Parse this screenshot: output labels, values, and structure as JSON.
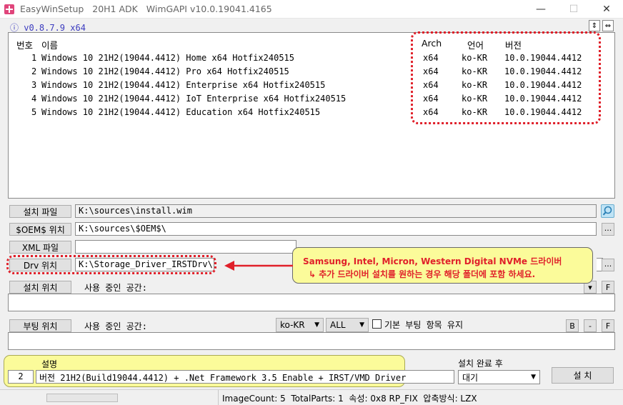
{
  "window": {
    "title": "EasyWinSetup   20H1 ADK   WimGAPI v10.0.19041.4165",
    "min_glyph": "—",
    "max_glyph": "☐",
    "close_glyph": "✕"
  },
  "version": "ⓘ v0.8.7.9 x64",
  "toolbar": {
    "sort_glyph": "⇕",
    "expand_glyph": "⇔"
  },
  "list": {
    "headers": {
      "num": "번호",
      "name": "이름",
      "arch": "Arch",
      "lang": "언어",
      "ver": "버전"
    },
    "rows": [
      {
        "num": "1",
        "name": "Windows 10 21H2(19044.4412) Home x64 Hotfix240515",
        "arch": "x64",
        "lang": "ko-KR",
        "ver": "10.0.19044.4412"
      },
      {
        "num": "2",
        "name": "Windows 10 21H2(19044.4412) Pro x64 Hotfix240515",
        "arch": "x64",
        "lang": "ko-KR",
        "ver": "10.0.19044.4412"
      },
      {
        "num": "3",
        "name": "Windows 10 21H2(19044.4412) Enterprise x64 Hotfix240515",
        "arch": "x64",
        "lang": "ko-KR",
        "ver": "10.0.19044.4412"
      },
      {
        "num": "4",
        "name": "Windows 10 21H2(19044.4412) IoT Enterprise x64 Hotfix240515",
        "arch": "x64",
        "lang": "ko-KR",
        "ver": "10.0.19044.4412"
      },
      {
        "num": "5",
        "name": "Windows 10 21H2(19044.4412) Education x64 Hotfix240515",
        "arch": "x64",
        "lang": "ko-KR",
        "ver": "10.0.19044.4412"
      }
    ]
  },
  "paths": {
    "install_label": "설치 파일",
    "install_value": "K:\\sources\\install.wim",
    "oem_label": "$OEM$ 위치",
    "oem_value": "K:\\sources\\$OEM$\\",
    "xml_label": "XML 파일",
    "xml_value": "",
    "drv_label": "Drv 위치",
    "drv_value": "K:\\Storage_Driver_IRSTDrv\\",
    "browse_glyph": "..."
  },
  "callout": {
    "line1": "Samsung, Intel, Micron, Western Digital NVMe 드라이버",
    "line2": "↳ 추가 드라이버 설치를 원하는 경우 해당 폴더에 포함 하세요."
  },
  "install_loc": {
    "label": "설치 위치",
    "used_space": "사용 중인 공간:",
    "f_glyph": "F"
  },
  "boot_loc": {
    "label": "부팅 위치",
    "used_space": "사용 중인 공간:",
    "lang_value": "ko-KR",
    "all_value": "ALL",
    "keep_label": "기본 부팅 항목 유지",
    "b_glyph": "B",
    "dash_glyph": "-",
    "f_glyph": "F"
  },
  "description": {
    "header": "설명",
    "num": "2",
    "text": "버전 21H2(Build19044.4412) + .Net Framework 3.5 Enable + IRST/VMD Driver"
  },
  "after_install": {
    "label": "설치 완료 후",
    "value": "대기",
    "install_button": "설 치"
  },
  "status": {
    "text": "ImageCount: 5  TotalParts: 1  속성: 0x8 RP_FIX  압축방식: LZX"
  }
}
